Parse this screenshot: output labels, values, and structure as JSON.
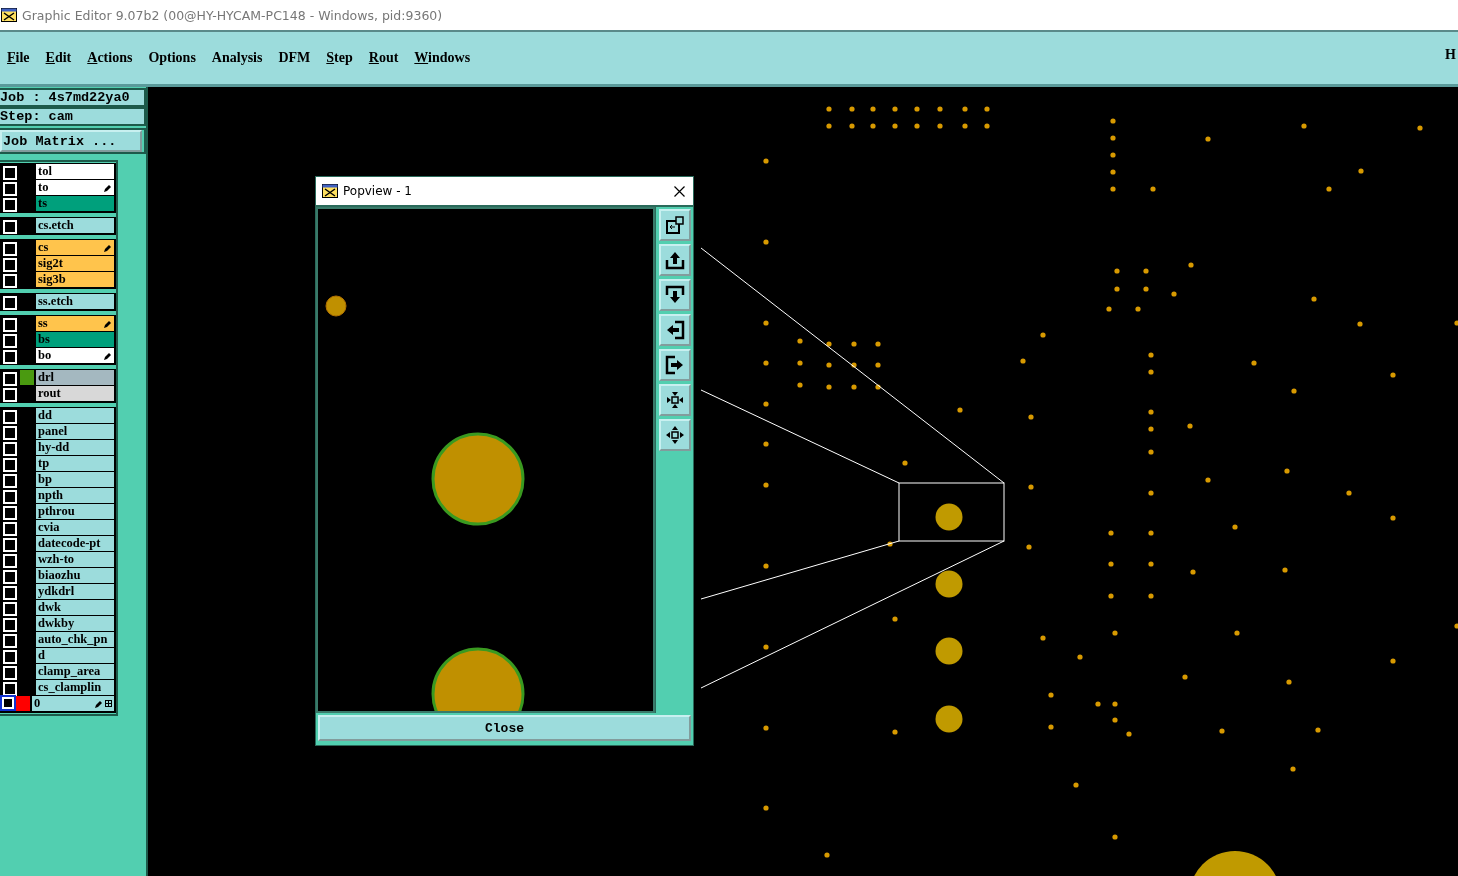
{
  "window": {
    "title": "Graphic Editor 9.07b2 (00@HY-HYCAM-PC148 - Windows, pid:9360)"
  },
  "menu": [
    {
      "label": "File",
      "mnemonic": true
    },
    {
      "label": "Edit",
      "mnemonic": true
    },
    {
      "label": "Actions",
      "mnemonic": true
    },
    {
      "label": "Options",
      "mnemonic": false
    },
    {
      "label": "Analysis",
      "mnemonic": false
    },
    {
      "label": "DFM",
      "mnemonic": false
    },
    {
      "label": "Step",
      "mnemonic": true
    },
    {
      "label": "Rout",
      "mnemonic": true
    },
    {
      "label": "Windows",
      "mnemonic": true
    }
  ],
  "menu_right": "H",
  "job": {
    "job_line": "Job : 4s7md22ya0",
    "step_line": "Step: cam",
    "matrix_button": "Job Matrix ..."
  },
  "layer_groups": [
    [
      {
        "name": "tol",
        "color": "#ffffff",
        "pen": false,
        "checked": false
      },
      {
        "name": "to",
        "color": "#ffffff",
        "pen": true,
        "checked": false
      },
      {
        "name": "ts",
        "color": "#00a07c",
        "pen": false,
        "checked": false
      }
    ],
    [
      {
        "name": "cs.etch",
        "color": "#9cdcdc",
        "pen": false,
        "checked": false
      }
    ],
    [
      {
        "name": "cs",
        "color": "#ffc44c",
        "pen": true,
        "checked": false
      },
      {
        "name": "sig2t",
        "color": "#ffc44c",
        "pen": false,
        "checked": false
      },
      {
        "name": "sig3b",
        "color": "#ffc44c",
        "pen": false,
        "checked": false
      }
    ],
    [
      {
        "name": "ss.etch",
        "color": "#9cdcdc",
        "pen": false,
        "checked": false
      }
    ],
    [
      {
        "name": "ss",
        "color": "#ffc44c",
        "pen": true,
        "checked": false
      },
      {
        "name": "bs",
        "color": "#00a07c",
        "pen": false,
        "checked": false
      },
      {
        "name": "bo",
        "color": "#ffffff",
        "pen": true,
        "checked": false
      }
    ],
    [
      {
        "name": "drl",
        "color": "#a4b8c0",
        "pen": false,
        "checked": false,
        "swatch": {
          "color": "#4a9a10"
        }
      },
      {
        "name": "rout",
        "color": "#d8d8d8",
        "pen": false,
        "checked": false
      }
    ],
    [
      {
        "name": "dd",
        "color": "#9cdcdc",
        "pen": false,
        "checked": false
      },
      {
        "name": "panel",
        "color": "#9cdcdc",
        "pen": false,
        "checked": false
      },
      {
        "name": "hy-dd",
        "color": "#9cdcdc",
        "pen": false,
        "checked": false
      },
      {
        "name": "tp",
        "color": "#9cdcdc",
        "pen": false,
        "checked": false
      },
      {
        "name": "bp",
        "color": "#9cdcdc",
        "pen": false,
        "checked": false
      },
      {
        "name": "npth",
        "color": "#9cdcdc",
        "pen": false,
        "checked": false
      },
      {
        "name": "pthrou",
        "color": "#9cdcdc",
        "pen": false,
        "checked": false
      },
      {
        "name": "cvia",
        "color": "#9cdcdc",
        "pen": false,
        "checked": false
      },
      {
        "name": "datecode-pt",
        "color": "#9cdcdc",
        "pen": false,
        "checked": false
      },
      {
        "name": "wzh-to",
        "color": "#9cdcdc",
        "pen": false,
        "checked": false
      },
      {
        "name": "biaozhu",
        "color": "#9cdcdc",
        "pen": false,
        "checked": false
      },
      {
        "name": "ydkdrl",
        "color": "#9cdcdc",
        "pen": false,
        "checked": false
      },
      {
        "name": "dwk",
        "color": "#9cdcdc",
        "pen": false,
        "checked": false
      },
      {
        "name": "dwkby",
        "color": "#9cdcdc",
        "pen": false,
        "checked": false
      },
      {
        "name": "auto_chk_pn",
        "color": "#9cdcdc",
        "pen": false,
        "checked": false
      },
      {
        "name": "d",
        "color": "#9cdcdc",
        "pen": false,
        "checked": false
      },
      {
        "name": "clamp_area",
        "color": "#9cdcdc",
        "pen": false,
        "checked": false
      },
      {
        "name": "cs_clamplin",
        "color": "#9cdcdc",
        "pen": false,
        "checked": false
      },
      {
        "name": "0",
        "color": "#9cdcdc",
        "pen": true,
        "checked": false,
        "swatch": {
          "color": "#ff0000"
        },
        "work_layer": true
      }
    ]
  ],
  "popview": {
    "title": "Popview - 1",
    "close_button": "Close",
    "tools": [
      {
        "kind": "window"
      },
      {
        "kind": "up"
      },
      {
        "kind": "down"
      },
      {
        "kind": "left"
      },
      {
        "kind": "right"
      },
      {
        "kind": "zoom-in"
      },
      {
        "kind": "zoom-out"
      }
    ]
  }
}
